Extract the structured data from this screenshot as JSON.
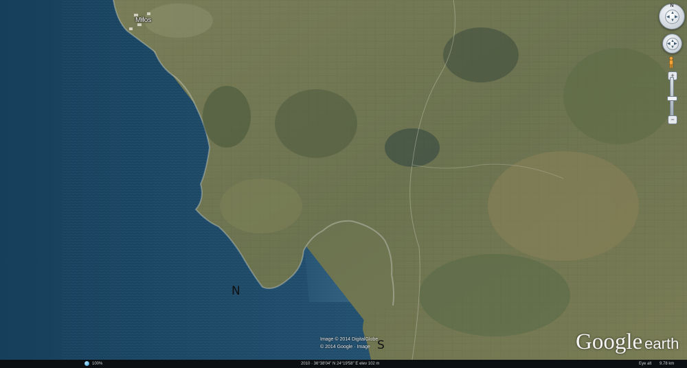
{
  "map": {
    "place_label": "Milos",
    "markers": [
      "N",
      "S"
    ],
    "attribution": [
      "Image © 2014 DigitalGlobe",
      "© 2014 Google · Image"
    ],
    "brand": {
      "google": "Google",
      "earth": "earth"
    }
  },
  "controls": {
    "look_north": "N",
    "zoom_in": "+",
    "zoom_out": "−",
    "icons": [
      "look-compass-icon",
      "move-joystick-icon",
      "pegman-icon",
      "zoom-slider-icon"
    ]
  },
  "statusbar": {
    "stream_value": "100%",
    "coordinates": "2010 · 36°38'04\" N  24°19'58\" E  elev  102 m",
    "eye_alt_label": "Eye alt",
    "eye_alt_value": "9.78 km"
  },
  "colors": {
    "sea_deep": "#1b4764",
    "sea_near": "#2e5f7e",
    "land": "#6f7752",
    "statusbar": "#0c0f12"
  }
}
